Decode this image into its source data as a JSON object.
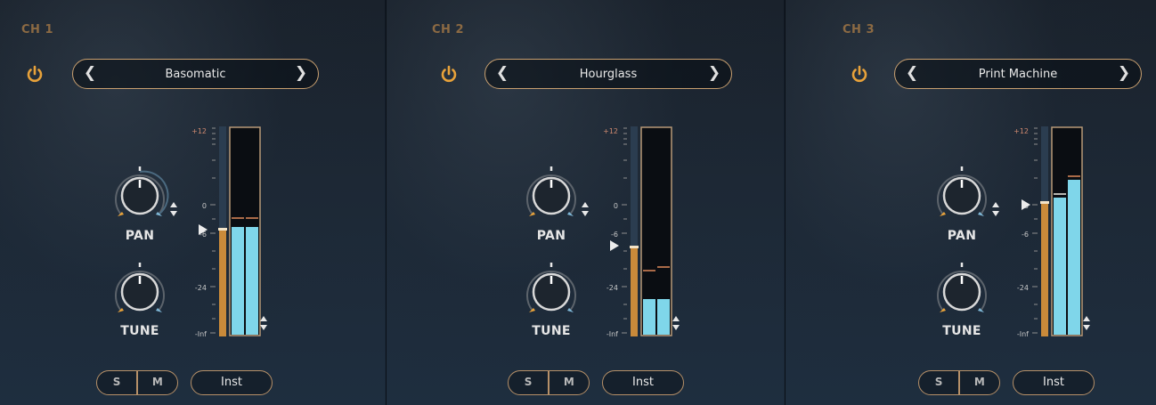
{
  "channels": [
    {
      "title": "CH 1",
      "preset": "Basomatic",
      "pan_label": "PAN",
      "tune_label": "TUNE",
      "solo_label": "S",
      "mute_label": "M",
      "output_label": "Inst",
      "meter_scale": [
        "+12",
        "0",
        "-6",
        "-24",
        "-Inf"
      ]
    },
    {
      "title": "CH 2",
      "preset": "Hourglass",
      "pan_label": "PAN",
      "tune_label": "TUNE",
      "solo_label": "S",
      "mute_label": "M",
      "output_label": "Inst",
      "meter_scale": [
        "+12",
        "0",
        "-6",
        "-24",
        "-Inf"
      ]
    },
    {
      "title": "CH 3",
      "preset": "Print Machine",
      "pan_label": "PAN",
      "tune_label": "TUNE",
      "solo_label": "S",
      "mute_label": "M",
      "output_label": "Inst",
      "meter_scale": [
        "+12",
        "0",
        "-6",
        "-24",
        "-Inf"
      ]
    }
  ],
  "colors": {
    "accent": "#e8a23a",
    "meter_level": "#7fd6ea",
    "fader": "#c98a3a",
    "frame": "#b69068"
  },
  "icons": {
    "power": "power-icon",
    "prev": "chevron-left-icon",
    "next": "chevron-right-icon",
    "updown": "up-down-arrows-icon"
  }
}
